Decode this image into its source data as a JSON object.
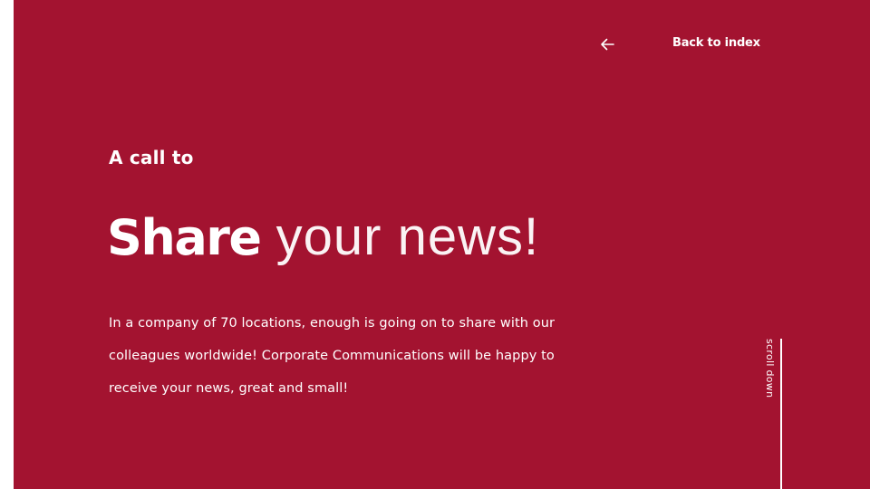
{
  "nav": {
    "back_label": "Back to index",
    "back_icon": "arrow-left-icon"
  },
  "hero": {
    "kicker": "A call to",
    "headline_strong": "Share",
    "headline_light": " your news!",
    "body": "In a company of 70 locations, enough is going on to share with our colleagues worldwide! Corporate Communications will be happy to receive your news, great and small!"
  },
  "scroll": {
    "label": "scroll down"
  },
  "colors": {
    "background": "#a31330",
    "text": "#ffffff"
  }
}
